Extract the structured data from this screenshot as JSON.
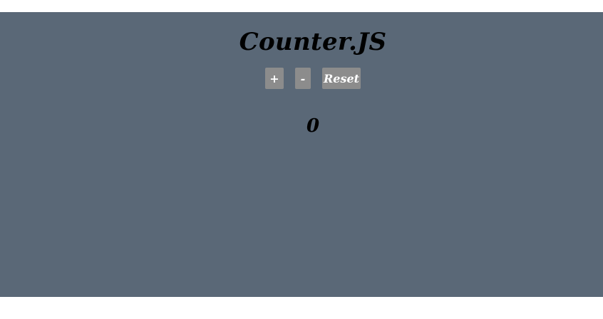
{
  "app": {
    "title": "Counter.JS"
  },
  "controls": {
    "increment_label": "+",
    "decrement_label": "-",
    "reset_label": "Reset"
  },
  "counter": {
    "value": "0"
  },
  "colors": {
    "panel_background": "#5a6877",
    "button_background": "#8c8c8c",
    "button_text": "#ffffff",
    "text": "#000000"
  }
}
